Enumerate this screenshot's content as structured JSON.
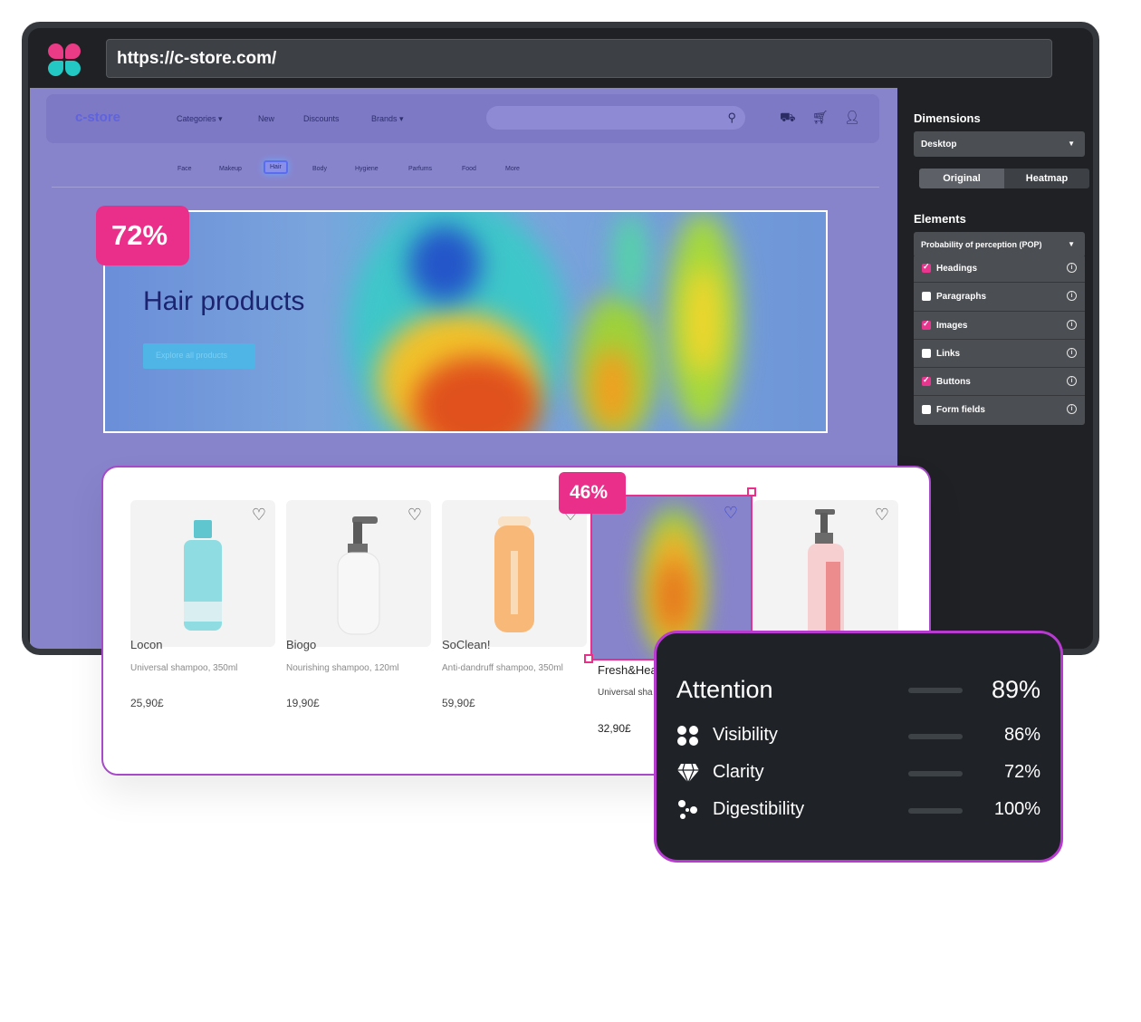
{
  "browser": {
    "url": "https://c-store.com/"
  },
  "site": {
    "logo": "c-store",
    "nav": [
      "Categories ▾",
      "New",
      "Discounts",
      "Brands ▾"
    ],
    "subnav": [
      "Face",
      "Makeup",
      "Hair",
      "Body",
      "Hygiene",
      "Parfums",
      "Food",
      "More"
    ],
    "active_subnav": "Hair",
    "banner_title": "Hair products",
    "banner_button": "Explore all products"
  },
  "panel": {
    "dimensions_label": "Dimensions",
    "dimensions_value": "Desktop",
    "view_options": [
      "Original",
      "Heatmap"
    ],
    "elements_label": "Elements",
    "metric_select": "Probability of perception (POP)",
    "elements": [
      {
        "label": "Headings",
        "checked": true
      },
      {
        "label": "Paragraphs",
        "checked": false
      },
      {
        "label": "Images",
        "checked": true
      },
      {
        "label": "Links",
        "checked": false
      },
      {
        "label": "Buttons",
        "checked": true
      },
      {
        "label": "Form fields",
        "checked": false
      }
    ],
    "colors": {
      "checked": "#e9358d",
      "unchecked": "#ffffff"
    }
  },
  "badges": {
    "banner": "72%",
    "product": "46%"
  },
  "products": [
    {
      "name": "Locon",
      "desc": "Universal shampoo, 350ml",
      "price": "25,90£"
    },
    {
      "name": "Biogo",
      "desc": "Nourishing shampoo, 120ml",
      "price": "19,90£"
    },
    {
      "name": "SoClean!",
      "desc": "Anti-dandruff shampoo, 350ml",
      "price": "59,90£"
    },
    {
      "name": "Fresh&Hea",
      "desc": "Universal sha",
      "price": "32,90£"
    },
    {
      "name": "",
      "desc": "",
      "price": ""
    }
  ],
  "attention": {
    "title": "Attention",
    "value": "89%",
    "fraction": 0.89,
    "metrics": [
      {
        "label": "Visibility",
        "value": "86%",
        "fraction": 0.86,
        "icon": "dots-icon",
        "color": "#2ea336"
      },
      {
        "label": "Clarity",
        "value": "72%",
        "fraction": 0.72,
        "icon": "diamond-icon",
        "color": "#9ccf32"
      },
      {
        "label": "Digestibility",
        "value": "100%",
        "fraction": 1.0,
        "icon": "molecule-icon",
        "color": "#2ea336"
      }
    ],
    "main_color": "#2ea336"
  }
}
